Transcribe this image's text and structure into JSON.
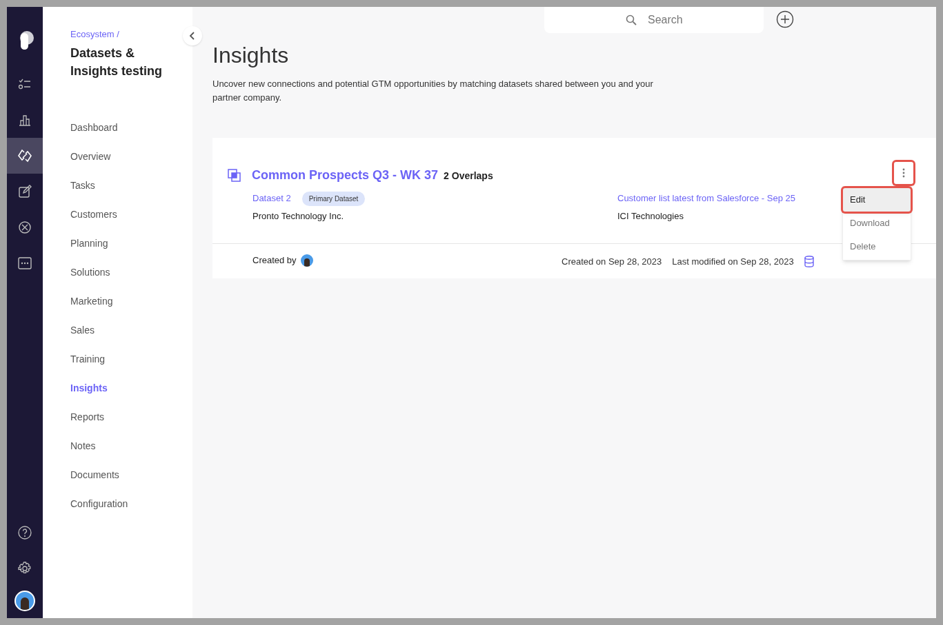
{
  "rail": {
    "items": [
      {
        "kind": "checklist",
        "selected": false
      },
      {
        "kind": "chart",
        "selected": false
      },
      {
        "kind": "link",
        "selected": true
      },
      {
        "kind": "edit",
        "selected": false
      },
      {
        "kind": "cancel",
        "selected": false
      },
      {
        "kind": "more",
        "selected": false
      }
    ],
    "bottom": [
      {
        "kind": "help"
      },
      {
        "kind": "settings"
      },
      {
        "kind": "avatar"
      }
    ]
  },
  "nav": {
    "breadcrumb": "Ecosystem /",
    "title": "Datasets & Insights testing",
    "items": [
      {
        "label": "Dashboard",
        "selected": false
      },
      {
        "label": "Overview",
        "selected": false
      },
      {
        "label": "Tasks",
        "selected": false
      },
      {
        "label": "Customers",
        "selected": false
      },
      {
        "label": "Planning",
        "selected": false
      },
      {
        "label": "Solutions",
        "selected": false
      },
      {
        "label": "Marketing",
        "selected": false
      },
      {
        "label": "Sales",
        "selected": false
      },
      {
        "label": "Training",
        "selected": false
      },
      {
        "label": "Insights",
        "selected": true
      },
      {
        "label": "Reports",
        "selected": false
      },
      {
        "label": "Notes",
        "selected": false
      },
      {
        "label": "Documents",
        "selected": false
      },
      {
        "label": "Configuration",
        "selected": false
      }
    ]
  },
  "search": {
    "placeholder": "Search"
  },
  "page": {
    "title": "Insights",
    "description": "Uncover new connections and potential GTM opportunities by matching datasets shared between you and your partner company."
  },
  "card": {
    "title": "Common Prospects Q3 - WK 37",
    "overlaps": "2 Overlaps",
    "datasets": [
      {
        "name": "Dataset 2",
        "badge": "Primary Dataset",
        "company": "Pronto Technology Inc."
      },
      {
        "name": "Customer list latest from Salesforce - Sep 25",
        "company": "ICI Technologies"
      }
    ],
    "created_by_label": "Created by",
    "created_on_label": "Created on",
    "created_on": "Sep 28, 2023",
    "modified_label": "Last modified on",
    "modified_on": "Sep 28, 2023",
    "menu_button": {
      "highlighted": true
    },
    "menu": [
      {
        "label": "Edit",
        "hovered": true,
        "highlighted": true
      },
      {
        "label": "Download",
        "hovered": false,
        "highlighted": false
      },
      {
        "label": "Delete",
        "hovered": false,
        "highlighted": false
      }
    ]
  }
}
